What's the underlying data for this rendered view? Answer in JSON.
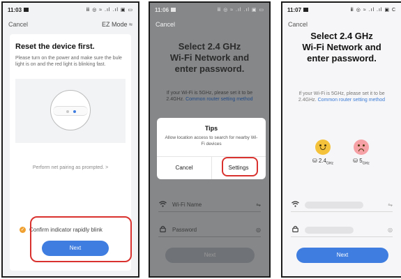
{
  "panel1": {
    "status_time": "11:03",
    "status_icons": "ⅲ ◎ ≈ .ıl .ıl ▣ ▭",
    "nav_left": "Cancel",
    "nav_right": "EZ Mode ≈",
    "title": "Reset the device first.",
    "description": "Please turn on the power and make sure the bule light is on and the red light is blinking fast.",
    "pair_text": "Perform net pairing as prompted. >",
    "confirm_text": "Confirm indicator rapidly blink",
    "next_label": "Next"
  },
  "panel2": {
    "status_time": "11:06",
    "status_icons": "ⅲ ◎ ≈ .ıl .ıl ▣ ▭",
    "nav_left": "Cancel",
    "title_line1": "Select 2.4 GHz",
    "title_line2": "Wi-Fi Network and",
    "title_line3": "enter password.",
    "desc": "If your Wi-Fi is 5GHz, please set it to be 2.4GHz.",
    "link": "Common router setting method",
    "dialog_title": "Tips",
    "dialog_message": "Allow location access to search for nearby Wi-Fi devices",
    "dialog_cancel": "Cancel",
    "dialog_settings": "Settings",
    "wifi_placeholder": "Wi-Fi Name",
    "password_placeholder": "Password",
    "next_label": "Next"
  },
  "panel3": {
    "status_time": "11:07",
    "status_icons": "ⅲ ◎ ≈ .ıl .ıl ▣ C",
    "nav_left": "Cancel",
    "title_line1": "Select 2.4 GHz",
    "title_line2": "Wi-Fi Network and",
    "title_line3": "enter password.",
    "desc": "If your Wi-Fi is 5GHz, please set it to be 2.4GHz.",
    "link": "Common router setting method",
    "band1_label": "2.4",
    "band1_unit": "GHz",
    "band2_label": "5",
    "band2_unit": "GHz",
    "next_label": "Next"
  },
  "colors": {
    "accent_blue": "#3f7ee0",
    "highlight_red": "#d9322e",
    "check_orange": "#f0a030",
    "happy_face": "#f5c23b",
    "sad_face": "#f6a1a6"
  },
  "icons": [
    "wifi-icon",
    "lock-icon",
    "swap-icon",
    "eye-icon",
    "router-icon",
    "check-icon",
    "happy-face-icon",
    "sad-face-icon",
    "chevron-right-icon"
  ]
}
